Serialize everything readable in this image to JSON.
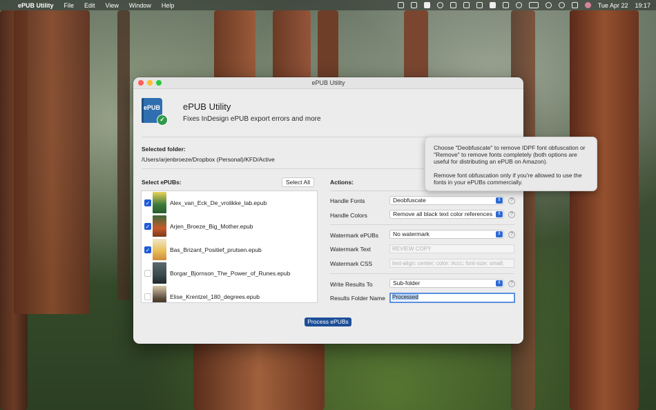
{
  "menubar": {
    "app_name": "ePUB Utility",
    "menus": [
      "File",
      "Edit",
      "View",
      "Window",
      "Help"
    ],
    "date": "Tue Apr 22",
    "time": "19:17"
  },
  "window": {
    "title": "ePUB Utility",
    "logo_text": "ePUB",
    "app_title": "ePUB Utility",
    "app_subtitle": "Fixes InDesign ePUB export errors and more",
    "folder_label": "Selected folder:",
    "folder_path": "/Users/arjenbroeze/Dropbox (Personal)/KFD/Active",
    "epubs_label": "Select ePUBs:",
    "select_all_label": "Select All",
    "epubs": [
      {
        "name": "Alex_van_Eck_De_vrolikke_lab.epub",
        "checked": true,
        "cover_color": "#3c7a3a"
      },
      {
        "name": "Arjen_Broeze_Big_Mother.epub",
        "checked": true,
        "cover_color": "#c85a2a"
      },
      {
        "name": "Bas_Brizant_Positief_prutsen.epub",
        "checked": true,
        "cover_color": "#e8c05a"
      },
      {
        "name": "Borgar_Bjornson_The_Power_of_Runes.epub",
        "checked": false,
        "cover_color": "#3a4a4e"
      },
      {
        "name": "Elise_Krentzel_180_degrees.epub",
        "checked": false,
        "cover_color": "#5a4a3a"
      }
    ],
    "actions_label": "Actions:",
    "handle_fonts_label": "Handle Fonts",
    "handle_fonts_value": "Deobfuscate",
    "handle_colors_label": "Handle Colors",
    "handle_colors_value": "Remove all black text color references",
    "watermark_label": "Watermark ePUBs",
    "watermark_value": "No watermark",
    "watermark_text_label": "Watermark Text",
    "watermark_text_placeholder": "REVIEW COPY",
    "watermark_css_label": "Watermark CSS",
    "watermark_css_placeholder": "text-align: center; color: #ccc; font-size: small;",
    "write_results_label": "Write Results To",
    "write_results_value": "Sub-folder",
    "results_folder_label": "Results Folder Name",
    "results_folder_value": "Processed",
    "process_button": "Process ePUBs",
    "help_glyph": "?"
  },
  "tooltip": {
    "para1": "Choose \"Deobfuscate\" to remove IDPF font obfuscation or \"Remove\" to remove fonts completely (both options are useful for distributing an ePUB on Amazon).",
    "para2": "Remove font obfuscation only if you're allowed to use the fonts in your ePUBs commercially."
  },
  "colors": {
    "accent": "#1f5bd6",
    "process_button": "#1d4f97"
  }
}
